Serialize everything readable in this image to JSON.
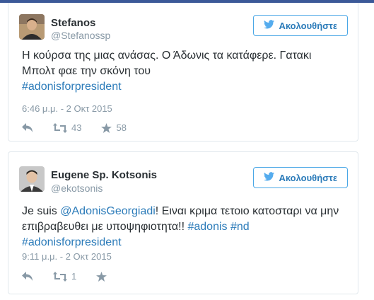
{
  "tweets": [
    {
      "name": "Stefanos",
      "handle": "@Stefanossp",
      "follow_label": "Ακολουθήστε",
      "text_plain": "Η κούρσα της μιας ανάσας. Ο Άδωνις τα κατάφερε. Γατακι Μπολτ φαε την σκόνη του",
      "hashtag": "#adonisforpresident",
      "timestamp": "6:46 μ.μ. - 2 Οκτ 2015",
      "retweets": "43",
      "likes": "58"
    },
    {
      "name": "Eugene Sp. Kotsonis",
      "handle": "@ekotsonis",
      "follow_label": "Ακολουθήστε",
      "text_prefix": "Je suis ",
      "mention": "@AdonisGeorgiadi",
      "text_middle": "! Ειναι κριμα τετοιο κατοσταρι να μην επιβραβευθει με υποψηφιοτητα!! ",
      "hashtag1": "#adonis",
      "hashtag2": "#nd",
      "hashtag3": "#adonisforpresident",
      "timestamp": "9:11 μ.μ. - 2 Οκτ 2015",
      "retweets": "1",
      "likes": ""
    }
  ],
  "colors": {
    "link": "#2b7bb9",
    "muted": "#8899a6",
    "border": "#e1e8ed",
    "follow_border": "#4aa7e6",
    "top_strip": "#3b5998"
  },
  "icons": [
    "twitter-bird-icon",
    "reply-icon",
    "retweet-icon",
    "star-icon"
  ]
}
